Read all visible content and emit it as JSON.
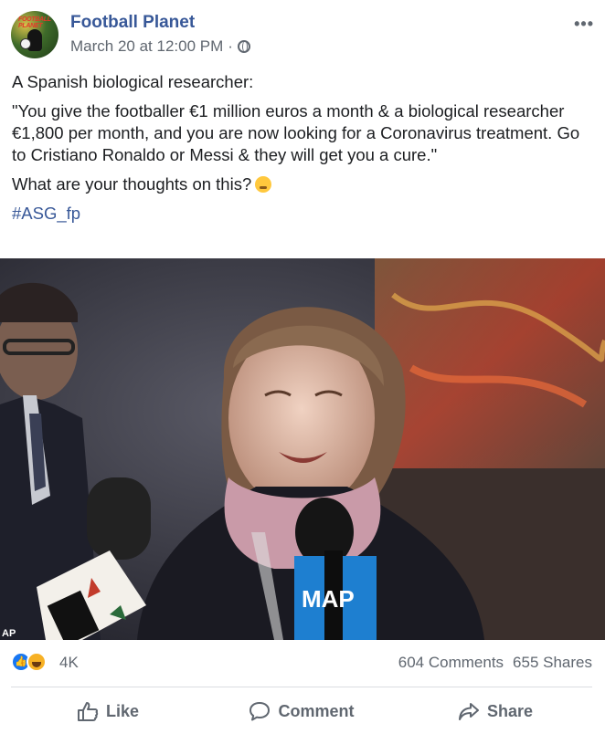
{
  "post": {
    "page_name": "Football Planet",
    "date": "March 20 at 12:00 PM",
    "separator": "·",
    "privacy_icon": "globe-icon",
    "more_label": "•••",
    "avatar_text": "FOOTBALL PLANET",
    "text_intro": "A Spanish biological researcher:",
    "text_quote": "\"You give the footballer €1 million euros a month & a biological researcher €1,800 per month, and you are now looking for a Coronavirus treatment. Go to Cristiano Ronaldo or Messi & they will get you a cure.\"",
    "text_question": "What are your thoughts on this?",
    "hashtag": "#ASG_fp"
  },
  "photo": {
    "mic_label": "MAP",
    "corner_text": "AP"
  },
  "reactions": {
    "icons": [
      "like-icon",
      "haha-icon"
    ],
    "count": "4K",
    "comments": "604 Comments",
    "shares": "655 Shares"
  },
  "actions": {
    "like": "Like",
    "comment": "Comment",
    "share": "Share"
  },
  "colors": {
    "link": "#385898",
    "meta": "#606770",
    "like_blue": "#1877f2",
    "divider": "#dadde1"
  }
}
